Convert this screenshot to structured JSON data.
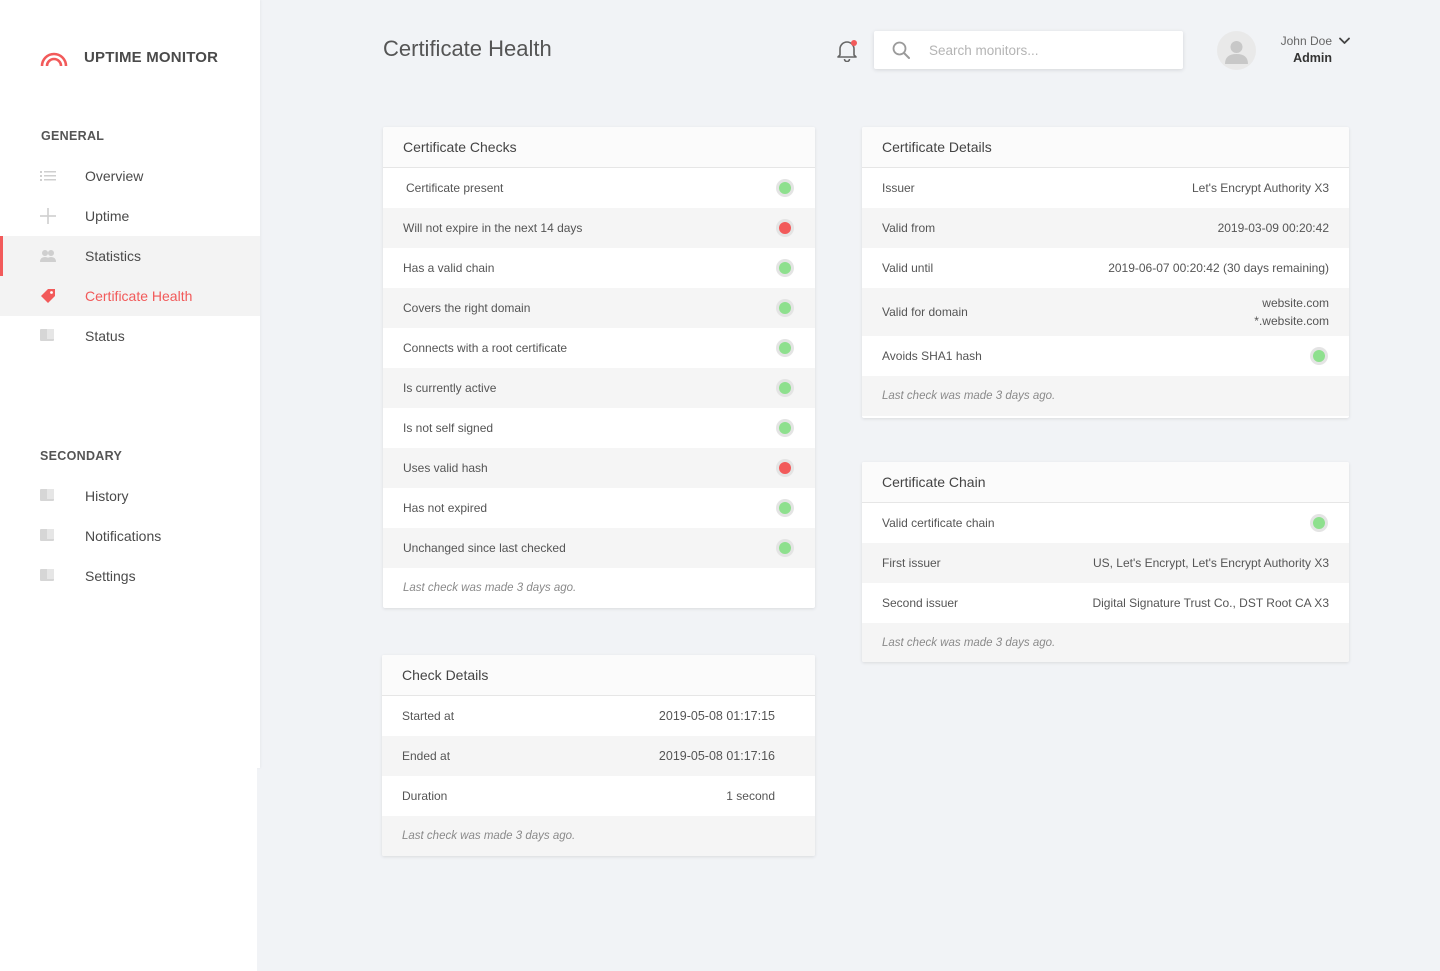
{
  "brand": {
    "name": "UPTIME MONITOR",
    "accent": "#f25a5a"
  },
  "sidebar": {
    "general_label": "GENERAL",
    "secondary_label": "SECONDARY",
    "general_items": [
      {
        "label": "Overview",
        "icon": "list-icon"
      },
      {
        "label": "Uptime",
        "icon": "plus-icon"
      },
      {
        "label": "Statistics",
        "icon": "users-icon"
      },
      {
        "label": "Certificate Health",
        "icon": "tag-icon"
      },
      {
        "label": "Status",
        "icon": "book-icon"
      }
    ],
    "secondary_items": [
      {
        "label": "History",
        "icon": "book-icon"
      },
      {
        "label": "Notifications",
        "icon": "book-icon"
      },
      {
        "label": "Settings",
        "icon": "book-icon"
      }
    ]
  },
  "header": {
    "title": "Certificate Health",
    "search_placeholder": "Search monitors...",
    "user_name": "John Doe",
    "user_role": "Admin"
  },
  "checks": {
    "title": "Certificate Checks",
    "items": [
      {
        "label": "Certificate present",
        "status": "ok"
      },
      {
        "label": "Will not expire in the next 14 days",
        "status": "fail"
      },
      {
        "label": "Has a valid chain",
        "status": "ok"
      },
      {
        "label": "Covers the right domain",
        "status": "ok"
      },
      {
        "label": "Connects with a root certificate",
        "status": "ok"
      },
      {
        "label": "Is currently active",
        "status": "ok"
      },
      {
        "label": "Is not self signed",
        "status": "ok"
      },
      {
        "label": "Uses valid hash",
        "status": "fail"
      },
      {
        "label": "Has not expired",
        "status": "ok"
      },
      {
        "label": "Unchanged since last checked",
        "status": "ok"
      }
    ],
    "footer": "Last check was made 3 days ago."
  },
  "check_details": {
    "title": "Check Details",
    "rows": [
      {
        "label": "Started at",
        "value": "2019-05-08 01:17:15"
      },
      {
        "label": "Ended at",
        "value": "2019-05-08 01:17:16"
      },
      {
        "label": "Duration",
        "value": "1 second"
      }
    ],
    "footer": "Last check was made 3 days ago."
  },
  "cert_details": {
    "title": "Certificate Details",
    "issuer_label": "Issuer",
    "issuer_value": "Let's Encrypt Authority X3",
    "valid_from_label": "Valid from",
    "valid_from_value": "2019-03-09 00:20:42",
    "valid_until_label": "Valid until",
    "valid_until_value": "2019-06-07 00:20:42 (30 days remaining)",
    "domain_label": "Valid for domain",
    "domain_values": [
      "website.com",
      "*.website.com"
    ],
    "sha1_label": "Avoids SHA1 hash",
    "sha1_status": "ok",
    "footer": "Last check was made 3 days ago."
  },
  "cert_chain": {
    "title": "Certificate Chain",
    "valid_chain_label": "Valid certificate chain",
    "valid_chain_status": "ok",
    "first_issuer_label": "First issuer",
    "first_issuer_value": "US, Let's Encrypt, Let's Encrypt Authority X3",
    "second_issuer_label": "Second issuer",
    "second_issuer_value": "Digital Signature Trust Co., DST Root CA X3",
    "footer": "Last check was made 3 days ago."
  },
  "colors": {
    "ok": "#8ee08e",
    "fail": "#f25a5a",
    "accent": "#f25a5a"
  }
}
